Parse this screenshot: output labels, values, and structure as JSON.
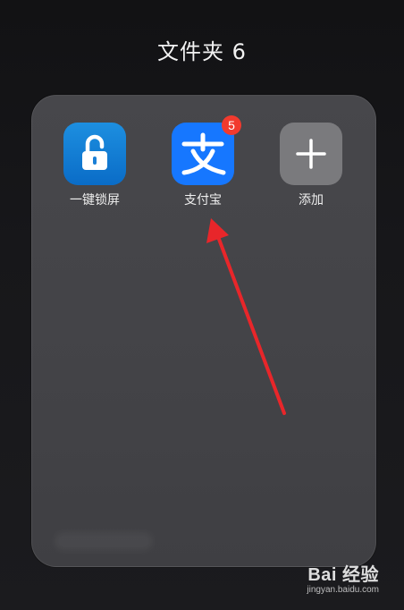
{
  "folder": {
    "title": "文件夹 6"
  },
  "apps": [
    {
      "label": "一键锁屏",
      "icon": "unlock-icon",
      "badge": ""
    },
    {
      "label": "支付宝",
      "icon": "alipay-icon",
      "badge": "5"
    },
    {
      "label": "添加",
      "icon": "plus-icon",
      "badge": ""
    }
  ],
  "annotation": {
    "arrow_color": "#e8262a"
  },
  "watermark": {
    "brand": "Bai 经验",
    "url": "jingyan.baidu.com"
  },
  "colors": {
    "alipay_blue": "#1677ff",
    "lock_blue": "#0a6cc7",
    "badge_red": "#f23a2e",
    "add_gray": "#7a7a7d"
  }
}
